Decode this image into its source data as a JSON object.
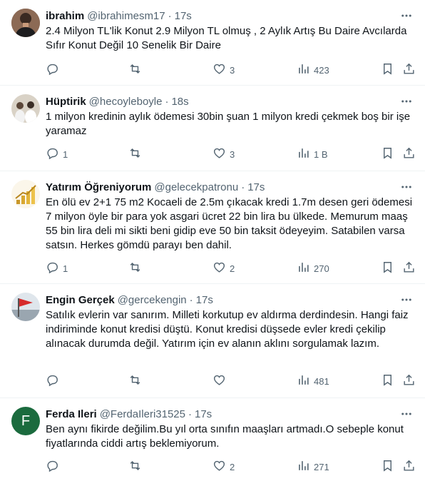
{
  "icons": {
    "reply": "reply-icon",
    "retweet": "retweet-icon",
    "like": "heart-icon",
    "views": "views-chart-icon",
    "bookmark": "bookmark-icon",
    "share": "share-icon",
    "more": "more-dots-icon"
  },
  "colors": {
    "text": "#0f1419",
    "secondary": "#536471",
    "divider": "#eff3f4",
    "avatar_ferda": "#1b6b3e"
  },
  "tweets": [
    {
      "name": "ibrahim",
      "handle": "@ibrahimesm17",
      "dot": "·",
      "time": "17s",
      "text": "2.4 Milyon TL'lik Konut 2.9 Milyon TL olmuş , 2 Aylık Artış Bu Daire Avcılarda Sıfır Konut Değil 10 Senelik Bir Daire",
      "replies": "",
      "retweets": "",
      "likes": "3",
      "views": "423"
    },
    {
      "name": "Hüptirik",
      "handle": "@hecoyleboyle",
      "dot": "·",
      "time": "18s",
      "text": "1 milyon kredinin aylık ödemesi 30bin şuan 1 milyon kredi çekmek boş bir işe yaramaz",
      "replies": "1",
      "retweets": "",
      "likes": "3",
      "views": "1 B"
    },
    {
      "name": "Yatırım Öğreniyorum",
      "handle": "@gelecekpatronu",
      "dot": "·",
      "time": "17s",
      "text": "En ölü ev 2+1 75 m2 Kocaeli de 2.5m çıkacak kredi 1.7m desen geri ödemesi 7 milyon öyle bir para yok asgari ücret 22 bin lira bu ülkede. Memurum maaş 55 bin lira deli mi sikti beni gidip eve 50 bin taksit ödeyeyim. Satabilen varsa satsın. Herkes gömdü parayı ben dahil.",
      "replies": "1",
      "retweets": "",
      "likes": "2",
      "views": "270"
    },
    {
      "name": "Engin Gerçek",
      "handle": "@gercekengin",
      "dot": "·",
      "time": "17s",
      "text": "Satılık evlerin var sanırım. Milleti korkutup ev aldırma derdindesin. Hangi faiz indiriminde konut kredisi düştü. Konut kredisi düşsede evler kredi çekilip alınacak durumda değil. Yatırım için ev alanın aklını sorgulamak lazım.",
      "replies": "",
      "retweets": "",
      "likes": "",
      "views": "481"
    },
    {
      "name": "Ferda Ileri",
      "handle": "@FerdaIleri31525",
      "dot": "·",
      "time": "17s",
      "avatar_letter": "F",
      "text": "Ben aynı fikirde değilim.Bu yıl orta sınıfın maaşları artmadı.O sebeple konut fiyatlarında ciddi artış beklemiyorum.",
      "replies": "",
      "retweets": "",
      "likes": "2",
      "views": "271"
    }
  ]
}
